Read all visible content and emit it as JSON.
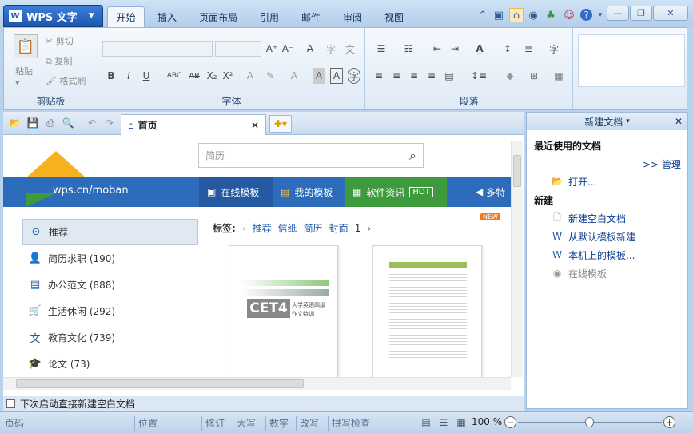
{
  "app": {
    "button_label": "WPS 文字",
    "logo_letter": "W"
  },
  "ribbon_tabs": [
    "开始",
    "插入",
    "页面布局",
    "引用",
    "邮件",
    "审阅",
    "视图"
  ],
  "clipboard": {
    "paste": "粘贴",
    "cut": "剪切",
    "copy": "复制",
    "format_painter": "格式刷",
    "group_label": "剪贴板"
  },
  "font_group": {
    "group_label": "字体",
    "font_name": "",
    "font_size": ""
  },
  "paragraph_group": {
    "group_label": "段落"
  },
  "doc_tab": {
    "label": "首页"
  },
  "search": {
    "placeholder": "简历"
  },
  "site": {
    "url": "wps.cn/moban"
  },
  "banner": {
    "online_templates": "在线模板",
    "my_templates": "我的模板",
    "software_news": "软件资讯",
    "hot_badge": "HOT",
    "more": "多特"
  },
  "tags": {
    "label": "标签:",
    "items": [
      "推荐",
      "信纸",
      "简历",
      "封面"
    ],
    "page": "1",
    "new_badge": "NEW"
  },
  "nav": [
    {
      "label": "推荐",
      "icon": "target-icon"
    },
    {
      "label": "简历求职 (190)",
      "icon": "id-card-icon"
    },
    {
      "label": "办公范文 (888)",
      "icon": "document-icon"
    },
    {
      "label": "生活休闲 (292)",
      "icon": "cart-icon"
    },
    {
      "label": "教育文化 (739)",
      "icon": "wen-char-icon"
    },
    {
      "label": "论文 (73)",
      "icon": "graduation-cap-icon"
    }
  ],
  "thumbnail": {
    "cet_title": "CET4",
    "cet_subtitle": "大学英语四级",
    "cet_subtitle2": "作文特训"
  },
  "footer": {
    "checkbox_label": "下次启动直接新建空白文档"
  },
  "taskpane": {
    "title": "新建文档",
    "recent_heading": "最近使用的文档",
    "manage_link": ">> 管理",
    "open_link": "打开...",
    "new_heading": "新建",
    "new_blank": "新建空白文档",
    "from_default": "从默认模板新建",
    "local_templates": "本机上的模板...",
    "online_templates": "在线模板"
  },
  "statusbar": {
    "page": "页码",
    "position": "位置",
    "revise": "修订",
    "caps": "大写",
    "num": "数字",
    "overwrite": "改写",
    "spellcheck": "拼写检查",
    "zoom": "100 %"
  },
  "colors": {
    "banner_blue": "#2d6cba",
    "banner_green": "#3d9a3d",
    "link_blue": "#0b3e8e"
  }
}
